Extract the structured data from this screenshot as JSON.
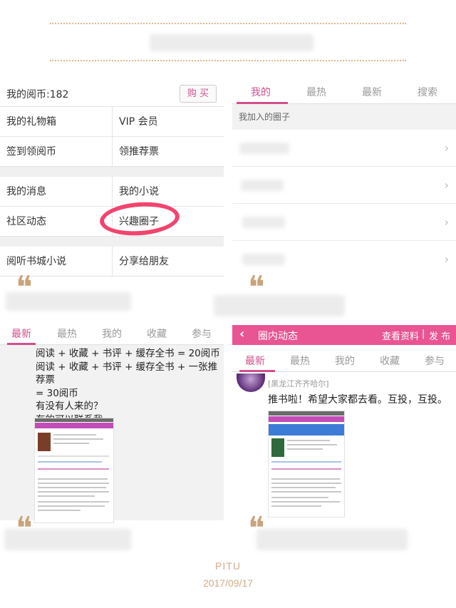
{
  "panel_account": {
    "coins_label": "我的阅币:182",
    "buy_button": "购 买",
    "menu": [
      {
        "left": "我的礼物箱",
        "right": "VIP 会员"
      },
      {
        "left": "签到领阅币",
        "right": "领推荐票"
      },
      {
        "left": "我的消息",
        "right": "我的小说"
      },
      {
        "left": "社区动态",
        "right": "兴趣圈子"
      },
      {
        "left": "阅听书城小说",
        "right": "分享给朋友"
      }
    ]
  },
  "panel_circles": {
    "tabs": [
      "我的",
      "最热",
      "最新",
      "搜索"
    ],
    "joined_label": "我加入的圈子",
    "chevron": "›"
  },
  "quote_mark": "❝",
  "panel_post": {
    "tabs": [
      "最新",
      "最热",
      "我的",
      "收藏",
      "参与"
    ],
    "lines": [
      "阅读 + 收藏 + 书评 + 缓存全书 = 20阅币",
      "阅读 + 收藏 + 书评 + 缓存全书 + 一张推荐票",
      "= 30阅币",
      "有没有人来的？",
      "有的可以联系我"
    ]
  },
  "panel_feed": {
    "back": "‹",
    "title": "圈内动态",
    "view_profile": "查看资料",
    "separator": "|",
    "publish": "发 布",
    "tabs": [
      "最新",
      "最热",
      "我的",
      "收藏",
      "参与"
    ],
    "post_user": "[黑龙江齐齐哈尔]",
    "post_text": "推书啦！希望大家都去看。互投，互投。"
  },
  "footer": {
    "brand": "PITU",
    "date": "2017/09/17"
  },
  "colors": {
    "accent": "#d0508c",
    "header_pink": "#e95493",
    "highlight_circle": "#f0456e",
    "gold": "#d1ab86"
  }
}
